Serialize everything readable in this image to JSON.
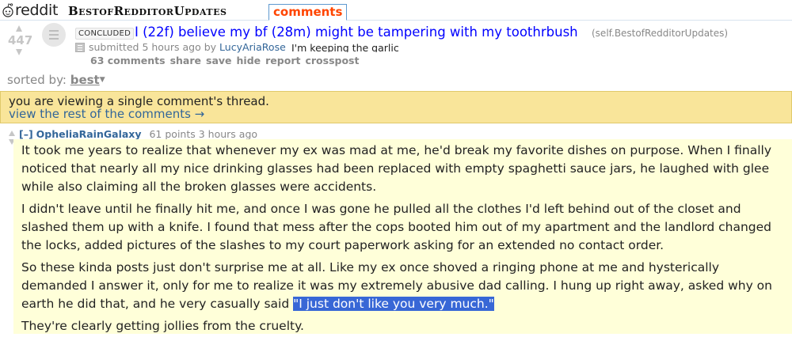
{
  "header": {
    "logo_text": "reddit",
    "subreddit": "BestofRedditorUpdates",
    "active_tab": "comments"
  },
  "post": {
    "score": "447",
    "flair": "CONCLUDED",
    "title": "I (22f) believe my bf (28m) might be tampering with my toothrbush",
    "domain": "(self.BestofRedditorUpdates)",
    "submitted_prefix": "submitted",
    "time_ago": "5 hours ago",
    "by": "by",
    "author": "LucyAriaRose",
    "preview": "I'm keeping the garlic",
    "buttons": [
      "63 comments",
      "share",
      "save",
      "hide",
      "report",
      "crosspost"
    ]
  },
  "sort": {
    "label": "sorted by:",
    "value": "best"
  },
  "infobar": {
    "line1": "you are viewing a single comment's thread.",
    "line2": "view the rest of the comments →"
  },
  "comment": {
    "collapse": "[–]",
    "author": "OpheliaRainGalaxy",
    "points": "61 points",
    "time_ago": "3 hours ago",
    "paragraphs": [
      "It took me years to realize that whenever my ex was mad at me, he'd break my favorite dishes on purpose. When I finally noticed that nearly all my nice drinking glasses had been replaced with empty spaghetti sauce jars, he laughed with glee while also claiming all the broken glasses were accidents.",
      "I didn't leave until he finally hit me, and once I was gone he pulled all the clothes I'd left behind out of the closet and slashed them up with a knife. I found that mess after the cops booted him out of my apartment and the landlord changed the locks, added pictures of the slashes to my court paperwork asking for an extended no contact order."
    ],
    "para3_text": "So these kinda posts just don't surprise me at all. Like my ex once shoved a ringing phone at me and hysterically demanded I answer it, only for me to realize it was my extremely abusive dad calling. I hung up right away, asked why on earth he did that, and he very casually said ",
    "para3_highlight": "\"I just don't like you very much.\"",
    "para4": "They're clearly getting jollies from the cruelty."
  },
  "colors": {
    "title_link": "#0000ff",
    "comment_bg": "#ffffd9",
    "infobar_bg": "#f9e59a",
    "highlight": "#3867d6",
    "tab_accent": "#ff4500"
  }
}
